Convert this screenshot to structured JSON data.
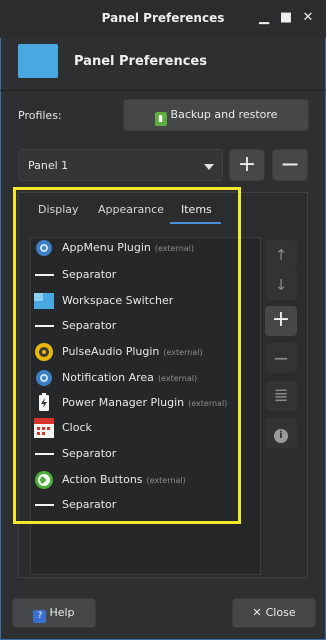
{
  "window": {
    "title": "Panel Preferences",
    "minimize": "▁",
    "maximize": "■",
    "close": "✕"
  },
  "header": {
    "title": "Panel Preferences"
  },
  "profiles": {
    "label": "Profiles:",
    "backup_label": "Backup and restore"
  },
  "panel_select": {
    "value": "Panel 1",
    "add": "+",
    "remove": "−"
  },
  "tabs": [
    {
      "label": "Display"
    },
    {
      "label": "Appearance"
    },
    {
      "label": "Items",
      "active": true
    }
  ],
  "items": [
    {
      "name": "AppMenu Plugin",
      "ext": "(external)",
      "icon": "gear-icon"
    },
    {
      "name": "Separator",
      "ext": "",
      "icon": "separator-icon"
    },
    {
      "name": "Workspace Switcher",
      "ext": "",
      "icon": "workspace-icon"
    },
    {
      "name": "Separator",
      "ext": "",
      "icon": "separator-icon"
    },
    {
      "name": "PulseAudio Plugin",
      "ext": "(external)",
      "icon": "speaker-icon"
    },
    {
      "name": "Notification Area",
      "ext": "(external)",
      "icon": "gear-icon"
    },
    {
      "name": "Power Manager Plugin",
      "ext": "(external)",
      "icon": "battery-icon"
    },
    {
      "name": "Clock",
      "ext": "",
      "icon": "calendar-icon"
    },
    {
      "name": "Separator",
      "ext": "",
      "icon": "separator-icon"
    },
    {
      "name": "Action Buttons",
      "ext": "(external)",
      "icon": "power-icon"
    },
    {
      "name": "Separator",
      "ext": "",
      "icon": "separator-icon"
    }
  ],
  "side_buttons": {
    "up": "↑",
    "down": "↓",
    "add": "+",
    "remove": "−",
    "list": "≣",
    "info": "i"
  },
  "footer": {
    "help_label": "Help",
    "close_label": "Close"
  },
  "colors": {
    "highlight": "#f2e928",
    "accent": "#4a90d9"
  }
}
